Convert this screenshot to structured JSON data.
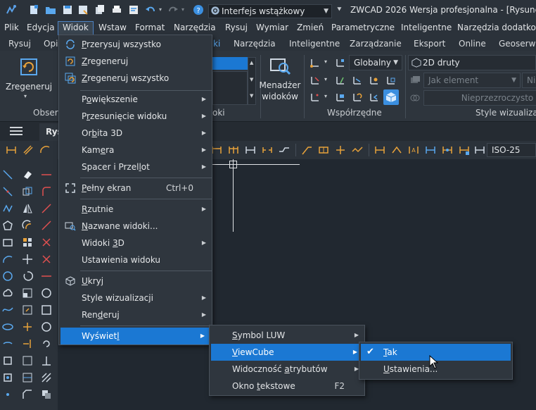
{
  "titlebar": {
    "workspace": "Interfejs wstążkowy",
    "title": "ZWCAD 2026 Wersja profesjonalna - [Rysunek"
  },
  "menubar": [
    "Plik",
    "Edycja",
    "Widok",
    "Wstaw",
    "Format",
    "Narzędzia",
    "Rysuj",
    "Wymiar",
    "Zmień",
    "Parametryczne",
    "Inteligentne",
    "Narzędzia dodatko"
  ],
  "ribbon_tabs": [
    "Rysuj",
    "Opi",
    "ki",
    "Narzędzia",
    "Inteligentne",
    "Zarządzanie",
    "Eksport",
    "Online",
    "Geoserwi"
  ],
  "ribbon": {
    "regen_label": "Zregeneruj",
    "obser_label": "Obser",
    "widoki_label": "oki",
    "view_manager_line1": "Menadżer",
    "view_manager_line2": "widoków",
    "coords_label": "Współrzędne",
    "ucs_combo": "Globalny",
    "visual_style_combo": "2D druty",
    "layer_combo": "Jak element",
    "ni_combo": "Nie",
    "transparency_combo": "Nieprzezroczysto",
    "visual_styles_label": "Style wizualizac"
  },
  "doc_tab": "Rys",
  "dim_style": "ISO-25",
  "view_menu": {
    "items": [
      {
        "label": "Przerysuj wszystko",
        "u": "P",
        "rest": "rzerysuj wszystko"
      },
      {
        "label": "Zregeneruj",
        "u": "Z",
        "rest": "regeneruj"
      },
      {
        "label": "Zregeneruj wszystko",
        "u": "Z",
        "rest": "regeneruj wszystko"
      },
      {
        "label": "Powiększenie",
        "u": "o",
        "pre": "P",
        "rest": "większenie"
      },
      {
        "label": "Przesunięcie widoku",
        "u": "r",
        "pre": "P",
        "rest": "zesunięcie widoku"
      },
      {
        "label": "Orbita 3D",
        "u": "b",
        "pre": "Or",
        "rest": "ita 3D"
      },
      {
        "label": "Kamera",
        "u": "e",
        "pre": "Kam",
        "rest": "ra"
      },
      {
        "label": "Spacer i Przelot",
        "u": "l",
        "pre": "Spacer i Przel",
        "rest": "ot"
      },
      {
        "label": "Pełny ekran",
        "u": "P",
        "rest": "ełny ekran"
      },
      {
        "label": "Rzutnie",
        "u": "R",
        "rest": "zutnie"
      },
      {
        "label": "Nazwane widoki...",
        "u": "N",
        "rest": "azwane widoki..."
      },
      {
        "label": "Widoki 3D",
        "u": "3",
        "pre": "Widoki ",
        "rest": "D"
      },
      {
        "label": "Ustawienia widoku",
        "u": "",
        "rest": "Ustawienia widoku"
      },
      {
        "label": "Ukryj",
        "u": "U",
        "rest": "kryj"
      },
      {
        "label": "Style wizualizacji",
        "u": "j",
        "pre": "Style wizualizac",
        "rest": "i"
      },
      {
        "label": "Renderuj",
        "u": "d",
        "pre": "Ren",
        "rest": "eruj"
      },
      {
        "label": "Wyświetl",
        "u": "l",
        "pre": "Wyświet",
        "rest": ""
      }
    ],
    "fullscreen_shortcut": "Ctrl+0"
  },
  "display_menu": {
    "items": [
      {
        "label": "Symbol LUW",
        "u": "S",
        "rest": "ymbol LUW"
      },
      {
        "label": "ViewCube",
        "u": "V",
        "rest": "iewCube"
      },
      {
        "label": "Widoczność atrybutów",
        "u": "a",
        "pre": "Widoczność ",
        "rest": "trybutów"
      },
      {
        "label": "Okno tekstowe",
        "u": "t",
        "pre": "Okno ",
        "rest": "ekstowe"
      }
    ],
    "text_window_shortcut": "F2"
  },
  "viewcube_menu": {
    "items": [
      {
        "label": "Tak",
        "u": "T",
        "rest": "ak"
      },
      {
        "label": "Ustawienia...",
        "u": "U",
        "rest": "stawienia..."
      }
    ]
  },
  "colors": {
    "highlight": "#1b78d3",
    "accent_blue": "#3b8fe0",
    "icon_orange": "#e8a23a",
    "icon_red": "#e05050"
  }
}
